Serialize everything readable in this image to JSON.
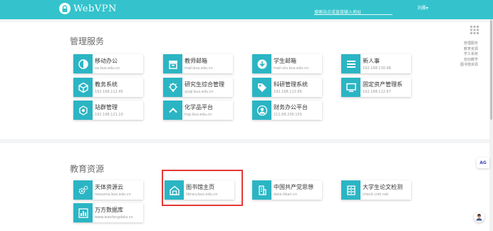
{
  "header": {
    "logo_text": "WebVPN",
    "search_placeholder": "搜索站点或直接输入地址",
    "user": "刘晨▾"
  },
  "sections": [
    {
      "title": "管理服务",
      "items": [
        {
          "title": "移动办公",
          "sub": "oa.bus.edu.cn",
          "icon": "half-circle-icon"
        },
        {
          "title": "教师邮箱",
          "sub": "mail.bus.edu.cn",
          "icon": "mail-box-icon"
        },
        {
          "title": "学生邮箱",
          "sub": "mail.stu.bus.edu.cn",
          "icon": "download-circle-icon"
        },
        {
          "title": "新人事",
          "sub": "192.168.130.98",
          "icon": "list-icon"
        },
        {
          "title": "教务系统",
          "sub": "192.168.112.45",
          "icon": "cube-icon"
        },
        {
          "title": "研究生综合管理",
          "sub": "yjsgl.bus.edu.cn",
          "icon": "gear-lightbulb-icon"
        },
        {
          "title": "科研管理系统",
          "sub": "192.168.112.66",
          "icon": "tag-icon"
        },
        {
          "title": "固定资产管理系",
          "sub": "192.168.112.67",
          "icon": "monitor-icon"
        },
        {
          "title": "站群管理",
          "sub": "192.168.121.10",
          "icon": "network-icon"
        },
        {
          "title": "化学品平台",
          "sub": "hxp.bus.edu.cn",
          "icon": "chevron-up-icon"
        },
        {
          "title": "财务办公平台",
          "sub": "211.68.236.155",
          "icon": "user-circle-icon"
        }
      ]
    },
    {
      "title": "教育资源",
      "items": [
        {
          "title": "天体资源云",
          "sub": "resource.bus.edu.cn",
          "icon": "gears-icon"
        },
        {
          "title": "图书馆主页",
          "sub": "library.bus.edu.cn",
          "icon": "home-icon"
        },
        {
          "title": "中国共产党思想",
          "sub": "data.tiban.cn",
          "icon": "building-icon"
        },
        {
          "title": "大学生论文检测",
          "sub": "check.cnki.net",
          "icon": "cabinet-icon"
        },
        {
          "title": "万方数据库",
          "sub": "www.wanfangdata.cn",
          "icon": "chart-icon"
        }
      ]
    }
  ],
  "side_nav": [
    "管理服务",
    "教育资源",
    "学工系统",
    "双创教学",
    "图书馆资源"
  ],
  "floating": {
    "ag_label": "AG"
  },
  "colors": {
    "header": "#34c3cc",
    "icon_bg": "#2bb5c4",
    "highlight": "#e53935"
  }
}
